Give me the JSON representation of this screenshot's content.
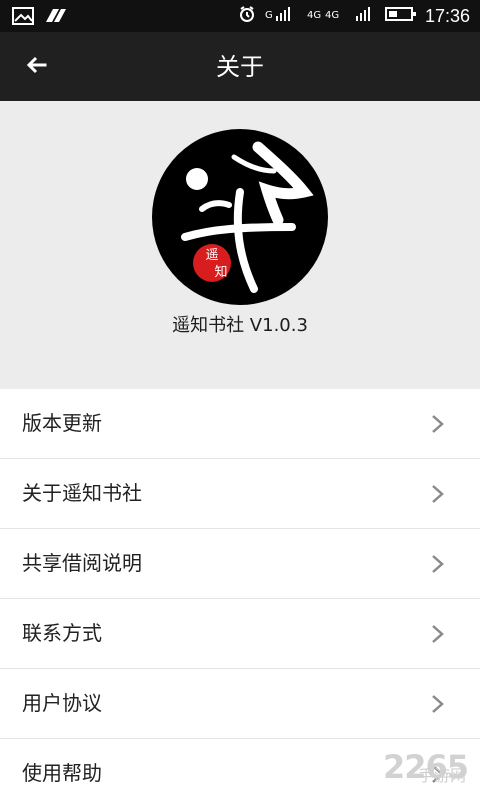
{
  "status_bar": {
    "time": "17:36",
    "left_icons": [
      "image-icon",
      "app-icon"
    ],
    "right_icons": [
      "alarm-icon",
      "signal-icon",
      "network-4g-icon",
      "signal-icon",
      "battery-icon"
    ]
  },
  "header": {
    "title": "关于",
    "back_icon": "back-arrow-icon"
  },
  "app": {
    "name_version": "遥知书社 V1.0.3"
  },
  "menu": {
    "items": [
      {
        "label": "版本更新"
      },
      {
        "label": "关于遥知书社"
      },
      {
        "label": "共享借阅说明"
      },
      {
        "label": "联系方式"
      },
      {
        "label": "用户协议"
      },
      {
        "label": "使用帮助"
      }
    ]
  },
  "watermark": {
    "text": "2265",
    "subtext": "手游网"
  },
  "colors": {
    "status_bar": "#111111",
    "top_bar": "#202020",
    "header_bg": "#ececec",
    "menu_bg": "#ffffff",
    "divider": "#e4e4e4",
    "logo_red": "#d71d1d"
  }
}
